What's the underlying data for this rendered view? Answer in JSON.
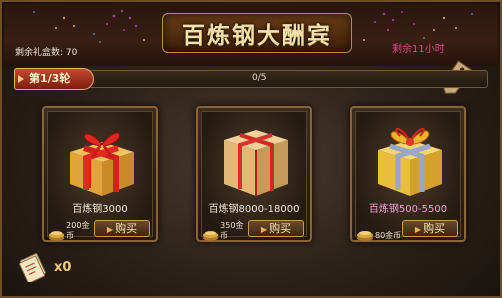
{
  "title": "百炼钢大酬宾",
  "remaining_boxes": "剩余礼盒数: 70",
  "remaining_time": "剩余11小时",
  "round": {
    "label": "第1/3轮",
    "progress_text": "0/5",
    "progress": 0
  },
  "cards": [
    {
      "name": "百炼钢3000",
      "price": "200金币",
      "buy_label": "购买",
      "name_color": "white"
    },
    {
      "name": "百炼钢8000-18000",
      "price": "350金币",
      "buy_label": "购买",
      "name_color": "white"
    },
    {
      "name": "百炼钢500-5500",
      "price": "80金币",
      "buy_label": "购买",
      "name_color": "pink"
    }
  ],
  "ticket_count": "x0",
  "icons": {
    "tag": "price-tag-icon",
    "ticket": "ticket-icon",
    "coin": "coin-stack-icon"
  },
  "colors": {
    "title": "#f3dfa8",
    "remaining_time": "#d74a8a",
    "round_label_bg": "#c2492e",
    "pink_name": "#f3a0d8",
    "frame_border": "#8a6338"
  }
}
